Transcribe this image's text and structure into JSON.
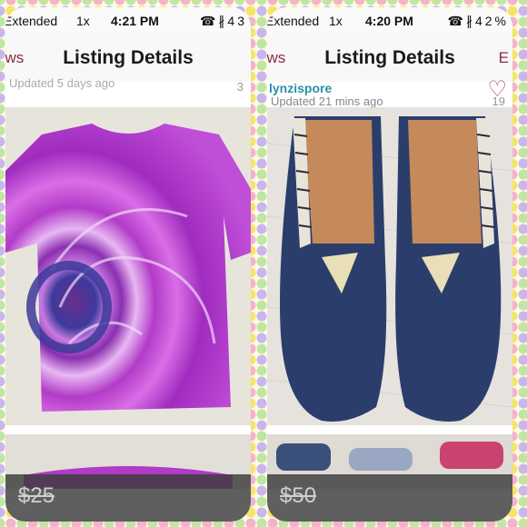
{
  "left": {
    "status": {
      "carrier": "Extended",
      "speed": "1x",
      "time": "4:21 PM",
      "battery": "43"
    },
    "nav": {
      "back": "ews",
      "title": "Listing Details"
    },
    "listing": {
      "updated": "Updated 5 days ago",
      "likes": "3"
    },
    "price": "$25"
  },
  "right": {
    "status": {
      "carrier": "Extended",
      "speed": "1x",
      "time": "4:20 PM",
      "battery": "42%"
    },
    "nav": {
      "back": "ews",
      "title": "Listing Details",
      "edge": "E"
    },
    "listing": {
      "seller": "lynzispore",
      "updated": "Updated 21 mins ago",
      "likes": "19"
    },
    "price": "$50"
  },
  "icons": [
    "wifi-icon",
    "bluetooth-icon",
    "heart-icon"
  ]
}
